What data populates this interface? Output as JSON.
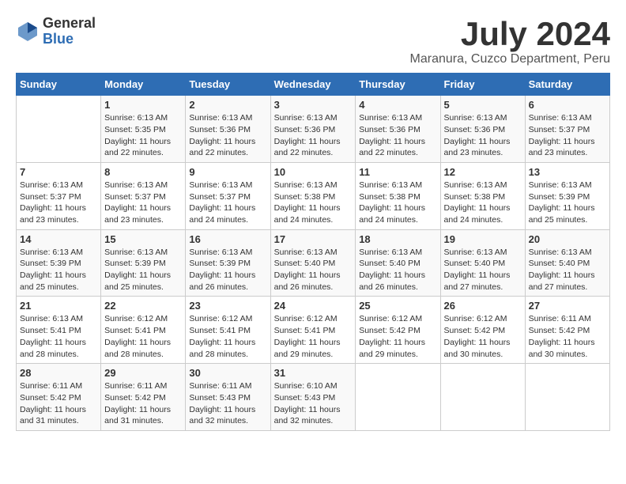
{
  "logo": {
    "general": "General",
    "blue": "Blue"
  },
  "title": {
    "month_year": "July 2024",
    "location": "Maranura, Cuzco Department, Peru"
  },
  "headers": [
    "Sunday",
    "Monday",
    "Tuesday",
    "Wednesday",
    "Thursday",
    "Friday",
    "Saturday"
  ],
  "weeks": [
    [
      {
        "day": "",
        "sunrise": "",
        "sunset": "",
        "daylight": ""
      },
      {
        "day": "1",
        "sunrise": "Sunrise: 6:13 AM",
        "sunset": "Sunset: 5:35 PM",
        "daylight": "Daylight: 11 hours and 22 minutes."
      },
      {
        "day": "2",
        "sunrise": "Sunrise: 6:13 AM",
        "sunset": "Sunset: 5:36 PM",
        "daylight": "Daylight: 11 hours and 22 minutes."
      },
      {
        "day": "3",
        "sunrise": "Sunrise: 6:13 AM",
        "sunset": "Sunset: 5:36 PM",
        "daylight": "Daylight: 11 hours and 22 minutes."
      },
      {
        "day": "4",
        "sunrise": "Sunrise: 6:13 AM",
        "sunset": "Sunset: 5:36 PM",
        "daylight": "Daylight: 11 hours and 22 minutes."
      },
      {
        "day": "5",
        "sunrise": "Sunrise: 6:13 AM",
        "sunset": "Sunset: 5:36 PM",
        "daylight": "Daylight: 11 hours and 23 minutes."
      },
      {
        "day": "6",
        "sunrise": "Sunrise: 6:13 AM",
        "sunset": "Sunset: 5:37 PM",
        "daylight": "Daylight: 11 hours and 23 minutes."
      }
    ],
    [
      {
        "day": "7",
        "sunrise": "Sunrise: 6:13 AM",
        "sunset": "Sunset: 5:37 PM",
        "daylight": "Daylight: 11 hours and 23 minutes."
      },
      {
        "day": "8",
        "sunrise": "Sunrise: 6:13 AM",
        "sunset": "Sunset: 5:37 PM",
        "daylight": "Daylight: 11 hours and 23 minutes."
      },
      {
        "day": "9",
        "sunrise": "Sunrise: 6:13 AM",
        "sunset": "Sunset: 5:37 PM",
        "daylight": "Daylight: 11 hours and 24 minutes."
      },
      {
        "day": "10",
        "sunrise": "Sunrise: 6:13 AM",
        "sunset": "Sunset: 5:38 PM",
        "daylight": "Daylight: 11 hours and 24 minutes."
      },
      {
        "day": "11",
        "sunrise": "Sunrise: 6:13 AM",
        "sunset": "Sunset: 5:38 PM",
        "daylight": "Daylight: 11 hours and 24 minutes."
      },
      {
        "day": "12",
        "sunrise": "Sunrise: 6:13 AM",
        "sunset": "Sunset: 5:38 PM",
        "daylight": "Daylight: 11 hours and 24 minutes."
      },
      {
        "day": "13",
        "sunrise": "Sunrise: 6:13 AM",
        "sunset": "Sunset: 5:39 PM",
        "daylight": "Daylight: 11 hours and 25 minutes."
      }
    ],
    [
      {
        "day": "14",
        "sunrise": "Sunrise: 6:13 AM",
        "sunset": "Sunset: 5:39 PM",
        "daylight": "Daylight: 11 hours and 25 minutes."
      },
      {
        "day": "15",
        "sunrise": "Sunrise: 6:13 AM",
        "sunset": "Sunset: 5:39 PM",
        "daylight": "Daylight: 11 hours and 25 minutes."
      },
      {
        "day": "16",
        "sunrise": "Sunrise: 6:13 AM",
        "sunset": "Sunset: 5:39 PM",
        "daylight": "Daylight: 11 hours and 26 minutes."
      },
      {
        "day": "17",
        "sunrise": "Sunrise: 6:13 AM",
        "sunset": "Sunset: 5:40 PM",
        "daylight": "Daylight: 11 hours and 26 minutes."
      },
      {
        "day": "18",
        "sunrise": "Sunrise: 6:13 AM",
        "sunset": "Sunset: 5:40 PM",
        "daylight": "Daylight: 11 hours and 26 minutes."
      },
      {
        "day": "19",
        "sunrise": "Sunrise: 6:13 AM",
        "sunset": "Sunset: 5:40 PM",
        "daylight": "Daylight: 11 hours and 27 minutes."
      },
      {
        "day": "20",
        "sunrise": "Sunrise: 6:13 AM",
        "sunset": "Sunset: 5:40 PM",
        "daylight": "Daylight: 11 hours and 27 minutes."
      }
    ],
    [
      {
        "day": "21",
        "sunrise": "Sunrise: 6:13 AM",
        "sunset": "Sunset: 5:41 PM",
        "daylight": "Daylight: 11 hours and 28 minutes."
      },
      {
        "day": "22",
        "sunrise": "Sunrise: 6:12 AM",
        "sunset": "Sunset: 5:41 PM",
        "daylight": "Daylight: 11 hours and 28 minutes."
      },
      {
        "day": "23",
        "sunrise": "Sunrise: 6:12 AM",
        "sunset": "Sunset: 5:41 PM",
        "daylight": "Daylight: 11 hours and 28 minutes."
      },
      {
        "day": "24",
        "sunrise": "Sunrise: 6:12 AM",
        "sunset": "Sunset: 5:41 PM",
        "daylight": "Daylight: 11 hours and 29 minutes."
      },
      {
        "day": "25",
        "sunrise": "Sunrise: 6:12 AM",
        "sunset": "Sunset: 5:42 PM",
        "daylight": "Daylight: 11 hours and 29 minutes."
      },
      {
        "day": "26",
        "sunrise": "Sunrise: 6:12 AM",
        "sunset": "Sunset: 5:42 PM",
        "daylight": "Daylight: 11 hours and 30 minutes."
      },
      {
        "day": "27",
        "sunrise": "Sunrise: 6:11 AM",
        "sunset": "Sunset: 5:42 PM",
        "daylight": "Daylight: 11 hours and 30 minutes."
      }
    ],
    [
      {
        "day": "28",
        "sunrise": "Sunrise: 6:11 AM",
        "sunset": "Sunset: 5:42 PM",
        "daylight": "Daylight: 11 hours and 31 minutes."
      },
      {
        "day": "29",
        "sunrise": "Sunrise: 6:11 AM",
        "sunset": "Sunset: 5:42 PM",
        "daylight": "Daylight: 11 hours and 31 minutes."
      },
      {
        "day": "30",
        "sunrise": "Sunrise: 6:11 AM",
        "sunset": "Sunset: 5:43 PM",
        "daylight": "Daylight: 11 hours and 32 minutes."
      },
      {
        "day": "31",
        "sunrise": "Sunrise: 6:10 AM",
        "sunset": "Sunset: 5:43 PM",
        "daylight": "Daylight: 11 hours and 32 minutes."
      },
      {
        "day": "",
        "sunrise": "",
        "sunset": "",
        "daylight": ""
      },
      {
        "day": "",
        "sunrise": "",
        "sunset": "",
        "daylight": ""
      },
      {
        "day": "",
        "sunrise": "",
        "sunset": "",
        "daylight": ""
      }
    ]
  ]
}
